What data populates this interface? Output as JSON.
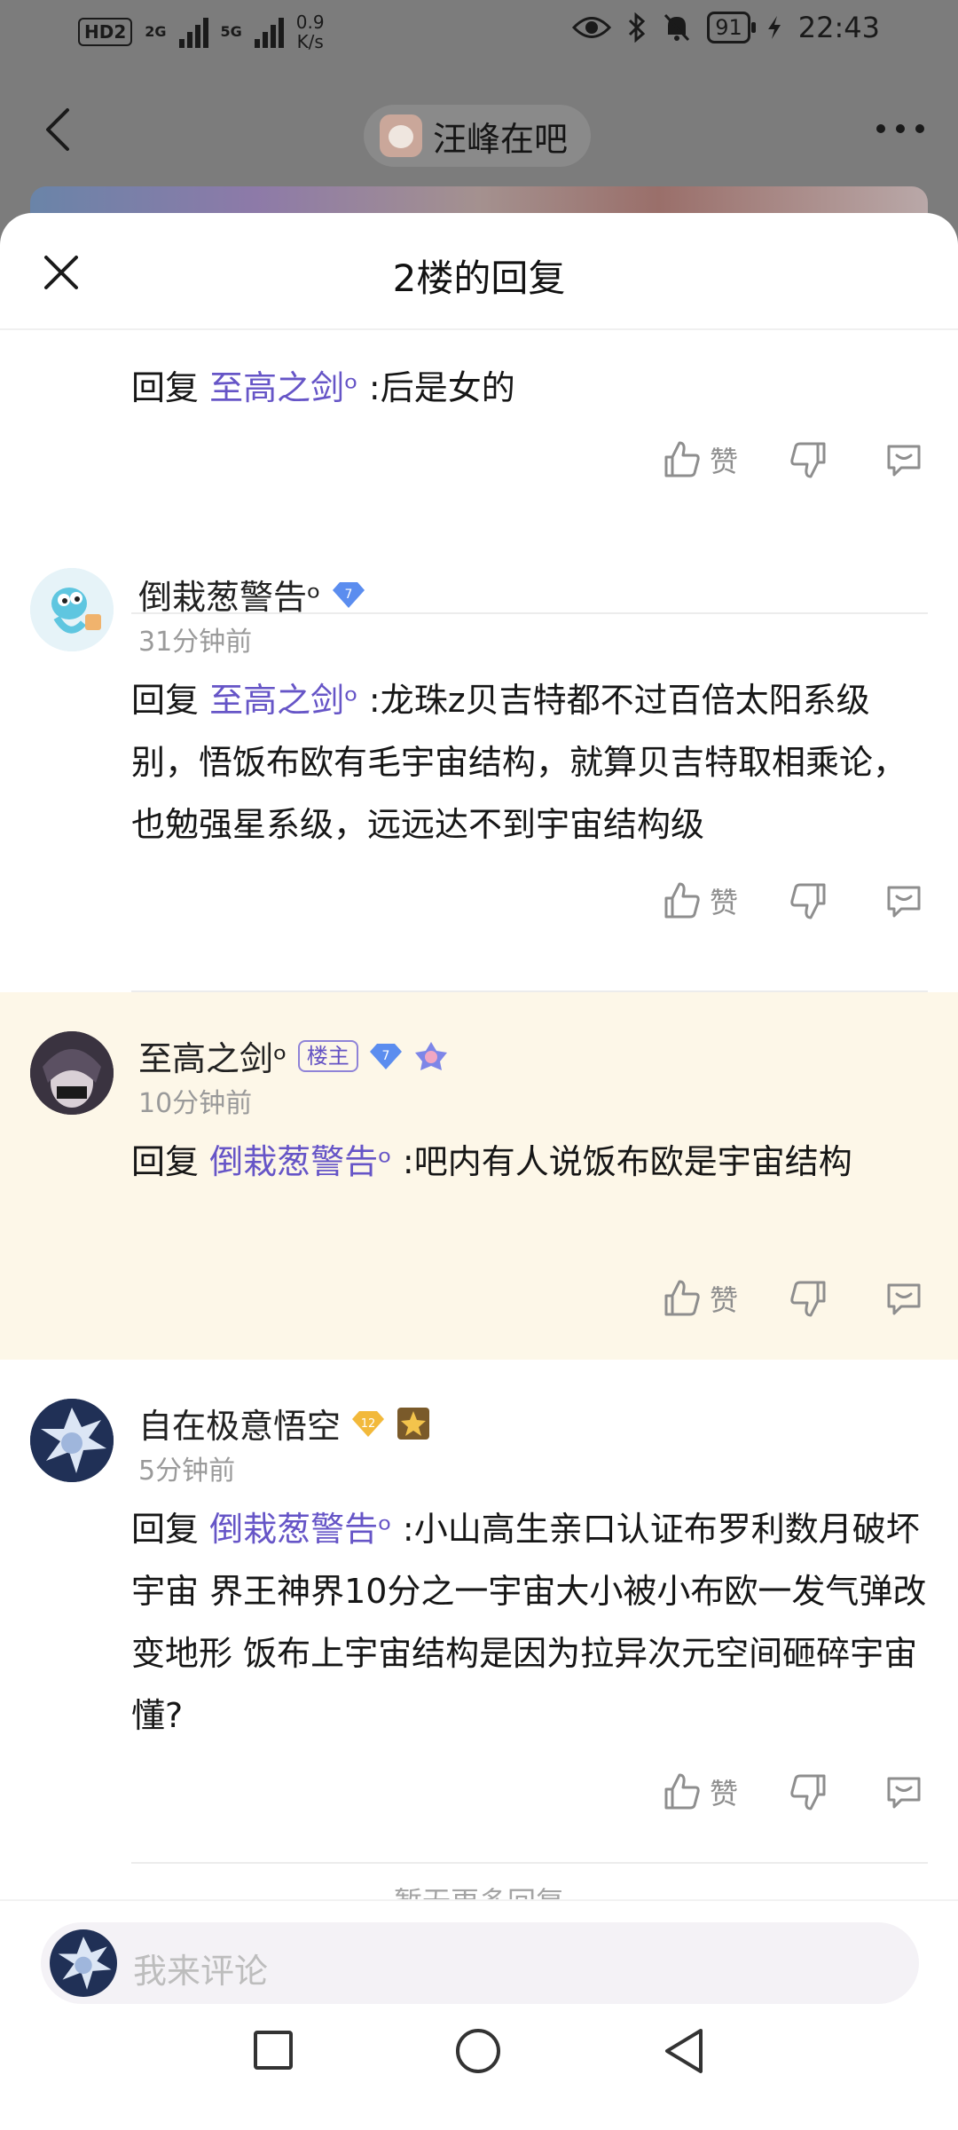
{
  "status_bar": {
    "hd": "HD",
    "hd_sub": "2",
    "net1": "2G",
    "net2": "5G",
    "speed_value": "0.9",
    "speed_unit": "K/s",
    "battery": "91",
    "time": "22:43"
  },
  "top_nav": {
    "forum_name": "汪峰在吧"
  },
  "sheet": {
    "title": "2楼的回复",
    "replies": [
      {
        "username": "",
        "time": "",
        "reply_prefix": "回复",
        "mention": "至高之剑ᵒ",
        "text": ":后是女的",
        "like_label": "赞"
      },
      {
        "username": "倒栽葱警告ᵒ",
        "level": "7",
        "time": "31分钟前",
        "reply_prefix": "回复",
        "mention": "至高之剑ᵒ",
        "text": ":龙珠z贝吉特都不过百倍太阳系级别，悟饭布欧有毛宇宙结构，就算贝吉特取相乘论，也勉强星系级，远远达不到宇宙结构级",
        "like_label": "赞"
      },
      {
        "username": "至高之剑ᵒ",
        "host_badge": "楼主",
        "level": "7",
        "time": "10分钟前",
        "reply_prefix": "回复",
        "mention": "倒栽葱警告ᵒ",
        "text": ":吧内有人说饭布欧是宇宙结构",
        "like_label": "赞"
      },
      {
        "username": "自在极意悟空",
        "level": "12",
        "time": "5分钟前",
        "reply_prefix": "回复",
        "mention": "倒栽葱警告ᵒ",
        "text": ":小山高生亲口认证布罗利数月破坏宇宙 界王神界10分之一宇宙大小被小布欧一发气弹改变地形 饭布上宇宙结构是因为拉异次元空间砸碎宇宙 懂?",
        "like_label": "赞"
      }
    ],
    "no_more": "暂无更多回复"
  },
  "comment_bar": {
    "placeholder": "我来评论"
  },
  "colors": {
    "mention": "#6655c7",
    "highlight_bg": "#fdf7e8",
    "level_blue": "#5b8def",
    "level_gold": "#f2b93b"
  }
}
